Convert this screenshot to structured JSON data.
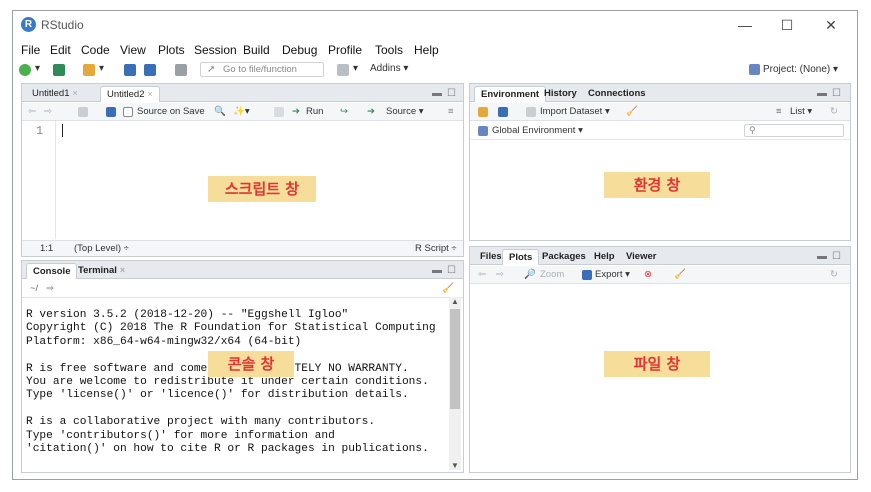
{
  "window": {
    "title": "RStudio",
    "logo_letter": "R",
    "controls": {
      "minimize": "—",
      "maximize": "☐",
      "close": "✕"
    }
  },
  "menu": [
    "File",
    "Edit",
    "Code",
    "View",
    "Plots",
    "Session",
    "Build",
    "Debug",
    "Profile",
    "Tools",
    "Help"
  ],
  "toolbar": {
    "goto_placeholder": "Go to file/function",
    "addins": "Addins",
    "project": "Project: (None)"
  },
  "editor": {
    "tabs": [
      {
        "label": "Untitled1",
        "close": "×"
      },
      {
        "label": "Untitled2",
        "close": "×"
      }
    ],
    "source_on_save": "Source on Save",
    "run": "Run",
    "source": "Source",
    "line_number": "1",
    "status_position": "1:1",
    "status_scope": "(Top Level) ÷",
    "status_type": "R Script ÷",
    "overlay": "스크립트 창"
  },
  "console": {
    "tabs": [
      {
        "label": "Console"
      },
      {
        "label": "Terminal",
        "close": "×"
      }
    ],
    "path": "~/",
    "lines": [
      "R version 3.5.2 (2018-12-20) -- \"Eggshell Igloo\"",
      "Copyright (C) 2018 The R Foundation for Statistical Computing",
      "Platform: x86_64-w64-mingw32/x64 (64-bit)",
      "",
      "R is free software and comes with ABSOLUTELY NO WARRANTY.",
      "You are welcome to redistribute it under certain conditions.",
      "Type 'license()' or 'licence()' for distribution details.",
      "",
      "R is a collaborative project with many contributors.",
      "Type 'contributors()' for more information and",
      "'citation()' on how to cite R or R packages in publications."
    ],
    "overlay": "콘솔 창"
  },
  "environment": {
    "tabs": [
      "Environment",
      "History",
      "Connections"
    ],
    "import_dataset": "Import Dataset",
    "list_view": "List",
    "scope": "Global Environment",
    "overlay": "환경 창"
  },
  "files": {
    "tabs": [
      "Files",
      "Plots",
      "Packages",
      "Help",
      "Viewer"
    ],
    "zoom": "Zoom",
    "export": "Export",
    "overlay": "파일 창"
  },
  "colors": {
    "accent_blue": "#3a7bc8",
    "overlay_bg": "#f6dd9a",
    "overlay_text": "#e13434"
  }
}
